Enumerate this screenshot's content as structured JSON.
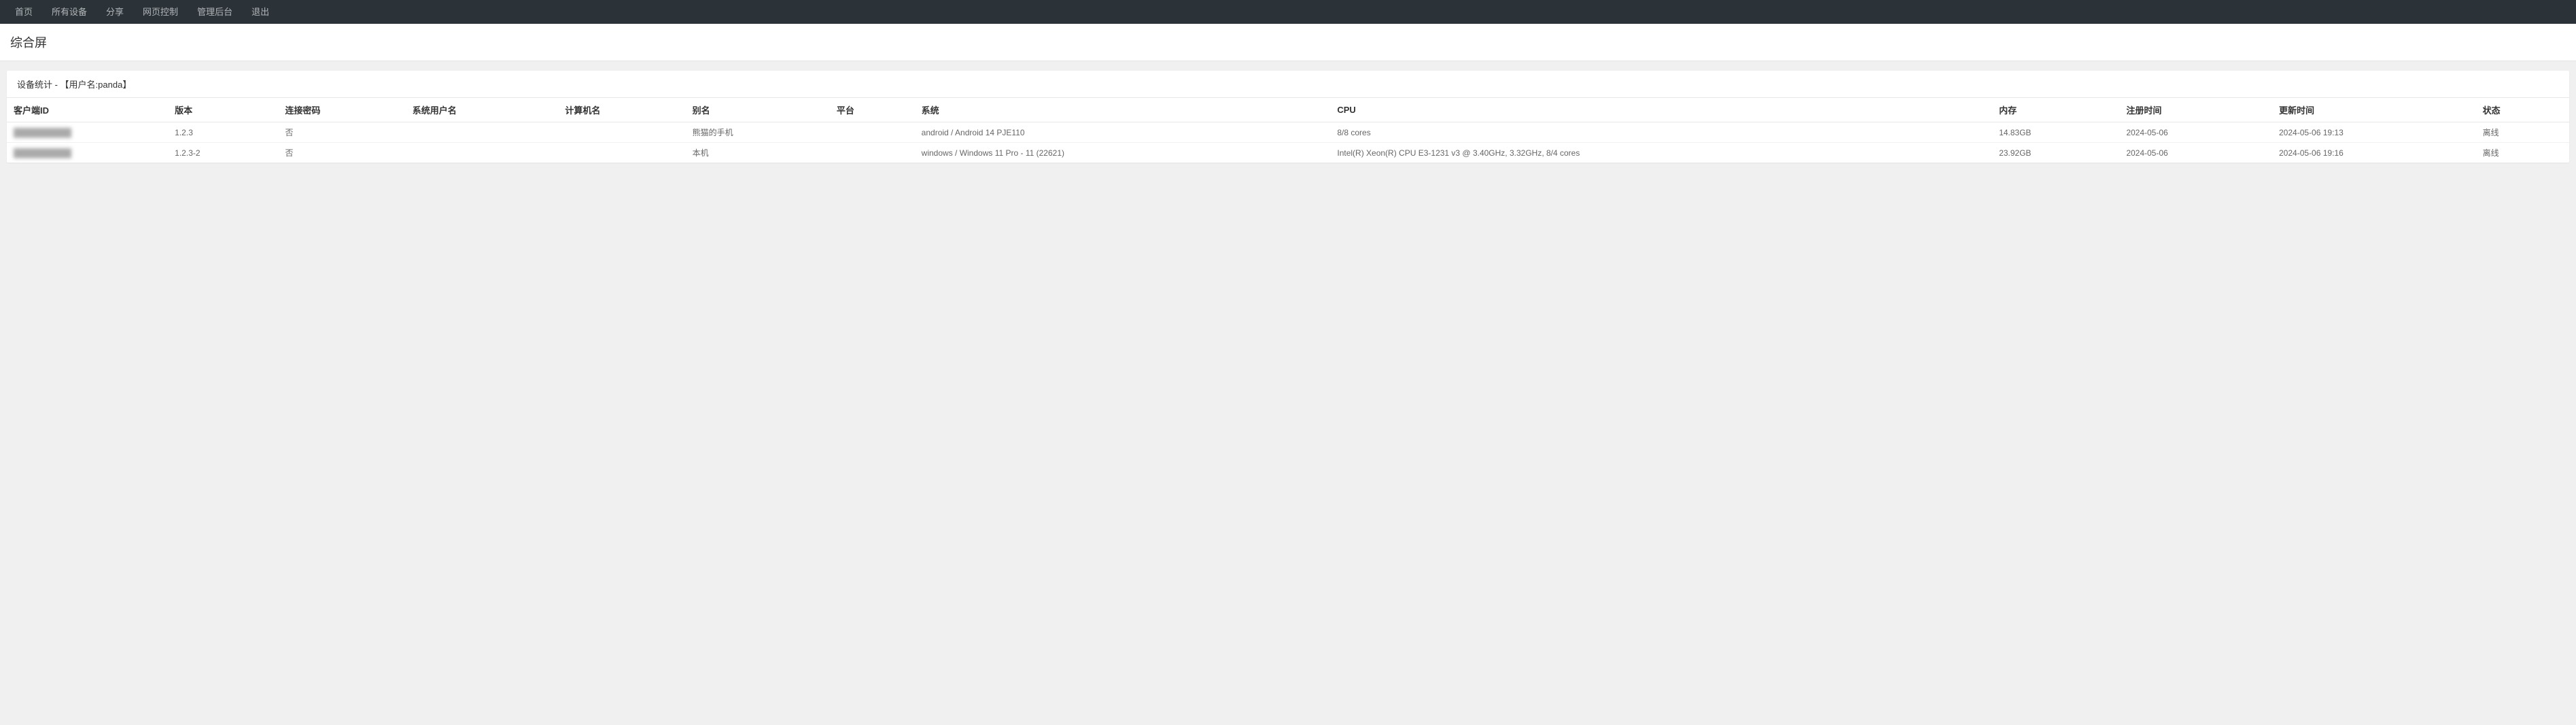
{
  "nav": {
    "items": [
      {
        "label": "首页"
      },
      {
        "label": "所有设备"
      },
      {
        "label": "分享"
      },
      {
        "label": "网页控制"
      },
      {
        "label": "管理后台"
      },
      {
        "label": "退出"
      }
    ]
  },
  "page": {
    "title": "综合屏"
  },
  "panel": {
    "title": "设备统计 - 【用户名:panda】"
  },
  "table": {
    "headers": {
      "client_id": "客户端ID",
      "version": "版本",
      "conn_password": "连接密码",
      "sys_user": "系统用户名",
      "computer_name": "计算机名",
      "alias": "别名",
      "platform": "平台",
      "system": "系统",
      "cpu": "CPU",
      "memory": "内存",
      "reg_time": "注册时间",
      "update_time": "更新时间",
      "status": "状态"
    },
    "rows": [
      {
        "client_id": "██████████",
        "version": "1.2.3",
        "conn_password": "否",
        "sys_user": "",
        "computer_name": "",
        "alias": "熊猫的手机",
        "platform": "",
        "system": "android / Android 14 PJE110",
        "cpu": "8/8 cores",
        "memory": "14.83GB",
        "reg_time": "2024-05-06",
        "update_time": "2024-05-06 19:13",
        "status": "离线"
      },
      {
        "client_id": "██████████",
        "version": "1.2.3-2",
        "conn_password": "否",
        "sys_user": "",
        "computer_name": "",
        "alias": "本机",
        "platform": "",
        "system": "windows / Windows 11 Pro - 11 (22621)",
        "cpu": "Intel(R) Xeon(R) CPU E3-1231 v3 @ 3.40GHz, 3.32GHz, 8/4 cores",
        "memory": "23.92GB",
        "reg_time": "2024-05-06",
        "update_time": "2024-05-06 19:16",
        "status": "离线"
      }
    ]
  }
}
